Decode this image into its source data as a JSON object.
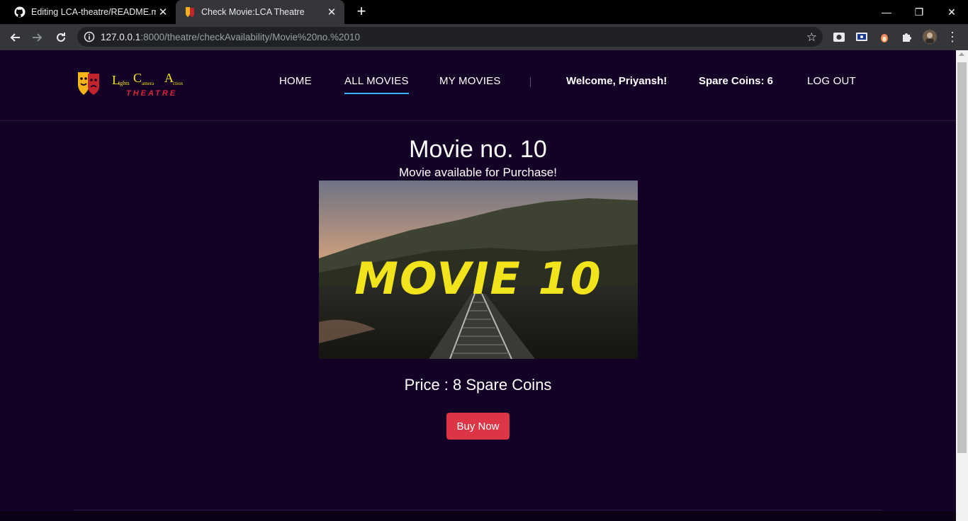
{
  "browser": {
    "tabs": [
      {
        "title": "Editing LCA-theatre/README.md",
        "favicon": "github-icon",
        "active": false
      },
      {
        "title": "Check Movie:LCA Theatre",
        "favicon": "theatre-mask-icon",
        "active": true
      }
    ],
    "url_host": "127.0.0.1",
    "url_rest": ":8000/theatre/checkAvailability/Movie%20no.%2010"
  },
  "nav": {
    "links": [
      "HOME",
      "ALL MOVIES",
      "MY MOVIES"
    ],
    "active_link": "ALL MOVIES",
    "welcome": "Welcome, Priyansh!",
    "coins": "Spare Coins: 6",
    "logout": "LOG OUT"
  },
  "logo": {
    "line1_caps": [
      "L",
      "C",
      "A"
    ],
    "line1_rest": [
      "ights",
      "amera",
      "ction"
    ],
    "line2": "THEATRE"
  },
  "movie": {
    "title": "Movie no. 10",
    "availability": "Movie available for Purchase!",
    "poster_text": "MOVIE 10",
    "price": "Price : 8 Spare Coins",
    "buy_label": "Buy Now"
  },
  "colors": {
    "page_bg": "#140126",
    "accent_underline": "#3ab3ff",
    "buy_button": "#dc3545",
    "poster_text": "#f2e41c"
  }
}
